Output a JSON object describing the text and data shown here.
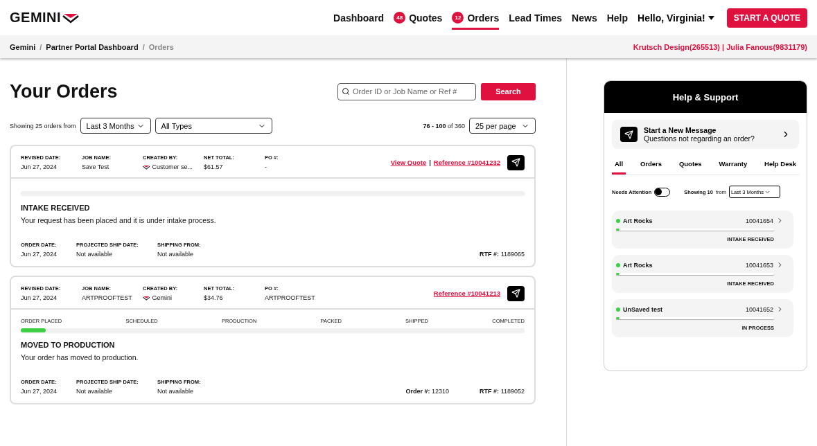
{
  "brand": "GEMINI",
  "nav": [
    {
      "label": "Dashboard",
      "selected": false
    },
    {
      "label": "Quotes",
      "badge": "48",
      "selected": false
    },
    {
      "label": "Orders",
      "badge": "12",
      "selected": true
    },
    {
      "label": "Lead Times",
      "selected": false
    },
    {
      "label": "News",
      "selected": false
    },
    {
      "label": "Help",
      "selected": false
    }
  ],
  "user_menu": "Hello, Virginia!",
  "cta": "START A QUOTE",
  "breadcrumb": [
    "Gemini",
    "Partner Portal Dashboard",
    "Orders"
  ],
  "breadcrumb_separator": "/",
  "link_separator": "|",
  "account": "Krutsch Design(265513) | Julia Fanous(9831179)",
  "page_title": "Your Orders",
  "search": {
    "placeholder": "Order ID or Job Name or Ref #",
    "button": "Search"
  },
  "filters": {
    "showing": "Showing 25 orders from",
    "period": "Last 3 Months",
    "type": "All Types",
    "range": "76 - 100",
    "range_of": "of 360",
    "per_page": "25 per page"
  },
  "orders": [
    {
      "fields": [
        {
          "label": "REVISED DATE:",
          "value": "Jun 27, 2024"
        },
        {
          "label": "JOB NAME:",
          "value": "Save Test"
        },
        {
          "label": "CREATED BY:",
          "value": "Customer se...",
          "kind": "creator"
        },
        {
          "label": "NET TOTAL:",
          "value": "$61.57"
        },
        {
          "label": "PO #:",
          "value": "-"
        }
      ],
      "links": [
        "View Quote",
        "Reference #10041232"
      ],
      "status": "INTAKE RECEIVED",
      "message": "Your request has been placed and it is under intake process.",
      "details": [
        {
          "label": "ORDER DATE:",
          "value": "Jun 27, 2024"
        },
        {
          "label": "PROJECTED SHIP DATE:",
          "value": "Not available"
        },
        {
          "label": "SHIPPING FROM:",
          "value": "Not available"
        }
      ],
      "refs": [
        {
          "label": "RTF #:",
          "value": "1189065"
        }
      ]
    },
    {
      "fields": [
        {
          "label": "REVISED DATE:",
          "value": "Jun 27, 2024"
        },
        {
          "label": "JOB NAME:",
          "value": "ARTPROOFTEST"
        },
        {
          "label": "CREATED BY:",
          "value": "Gemini",
          "kind": "creator"
        },
        {
          "label": "NET TOTAL:",
          "value": "$34.76"
        },
        {
          "label": "PO #:",
          "value": "ARTPROOFTEST"
        }
      ],
      "links": [
        "Reference #10041213"
      ],
      "stages": [
        "ORDER PLACED",
        "SCHEDULED",
        "PRODUCTION",
        "PACKED",
        "SHIPPED",
        "COMPLETED"
      ],
      "level": 0.05,
      "status": "MOVED TO PRODUCTION",
      "message": "Your order has moved to production.",
      "details": [
        {
          "label": "ORDER DATE:",
          "value": "Jun 27, 2024"
        },
        {
          "label": "PROJECTED SHIP DATE:",
          "value": "Not available"
        },
        {
          "label": "SHIPPING FROM:",
          "value": "Not available"
        }
      ],
      "refs": [
        {
          "label": "Order #:",
          "value": "12310"
        },
        {
          "label": "RTF #:",
          "value": "1189052"
        }
      ]
    }
  ],
  "help": {
    "title": "Help & Support",
    "new_message": {
      "title": "Start a New Message",
      "subtitle": "Questions not regarding an order?"
    },
    "tabs": [
      {
        "label": "All",
        "selected": true
      },
      {
        "label": "Orders",
        "selected": false
      },
      {
        "label": "Quotes",
        "selected": false
      },
      {
        "label": "Warranty",
        "selected": false
      },
      {
        "label": "Help Desk",
        "selected": false
      }
    ],
    "needs_attention": {
      "label": "Needs Attention",
      "on": false
    },
    "showing": "Showing 10",
    "from": "from",
    "period": "Last 3 Months",
    "messages": [
      {
        "name": "Art Rocks",
        "number": "10041654",
        "status": "INTAKE RECEIVED",
        "level": 0,
        "color": "#3ecf45"
      },
      {
        "name": "Art Rocks",
        "number": "10041653",
        "status": "INTAKE RECEIVED",
        "level": 0,
        "color": "#3ecf45"
      },
      {
        "name": "UnSaved test",
        "number": "10041652",
        "status": "IN PROCESS",
        "level": 0,
        "color": "#3ecf45"
      }
    ]
  }
}
